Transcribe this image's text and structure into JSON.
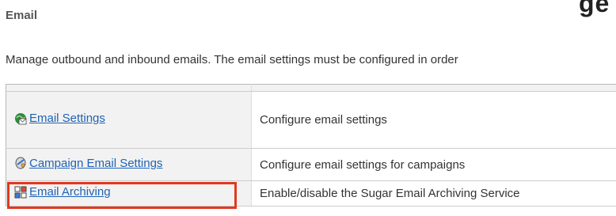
{
  "header": {
    "partial_title": "ge"
  },
  "section": {
    "title": "Email",
    "description": "Manage outbound and inbound emails. The email settings must be configured in order"
  },
  "rows": [
    {
      "icon": "email-settings-icon",
      "link": "Email Settings",
      "description": "Configure email settings"
    },
    {
      "icon": "campaign-email-icon",
      "link": "Campaign Email Settings",
      "description": "Configure email settings for campaigns"
    },
    {
      "icon": "email-archiving-icon",
      "link": "Email Archiving",
      "description": "Enable/disable the Sugar Email Archiving Service"
    }
  ],
  "colors": {
    "link": "#1f63b5",
    "highlight": "#e2381f",
    "title": "#555555"
  }
}
